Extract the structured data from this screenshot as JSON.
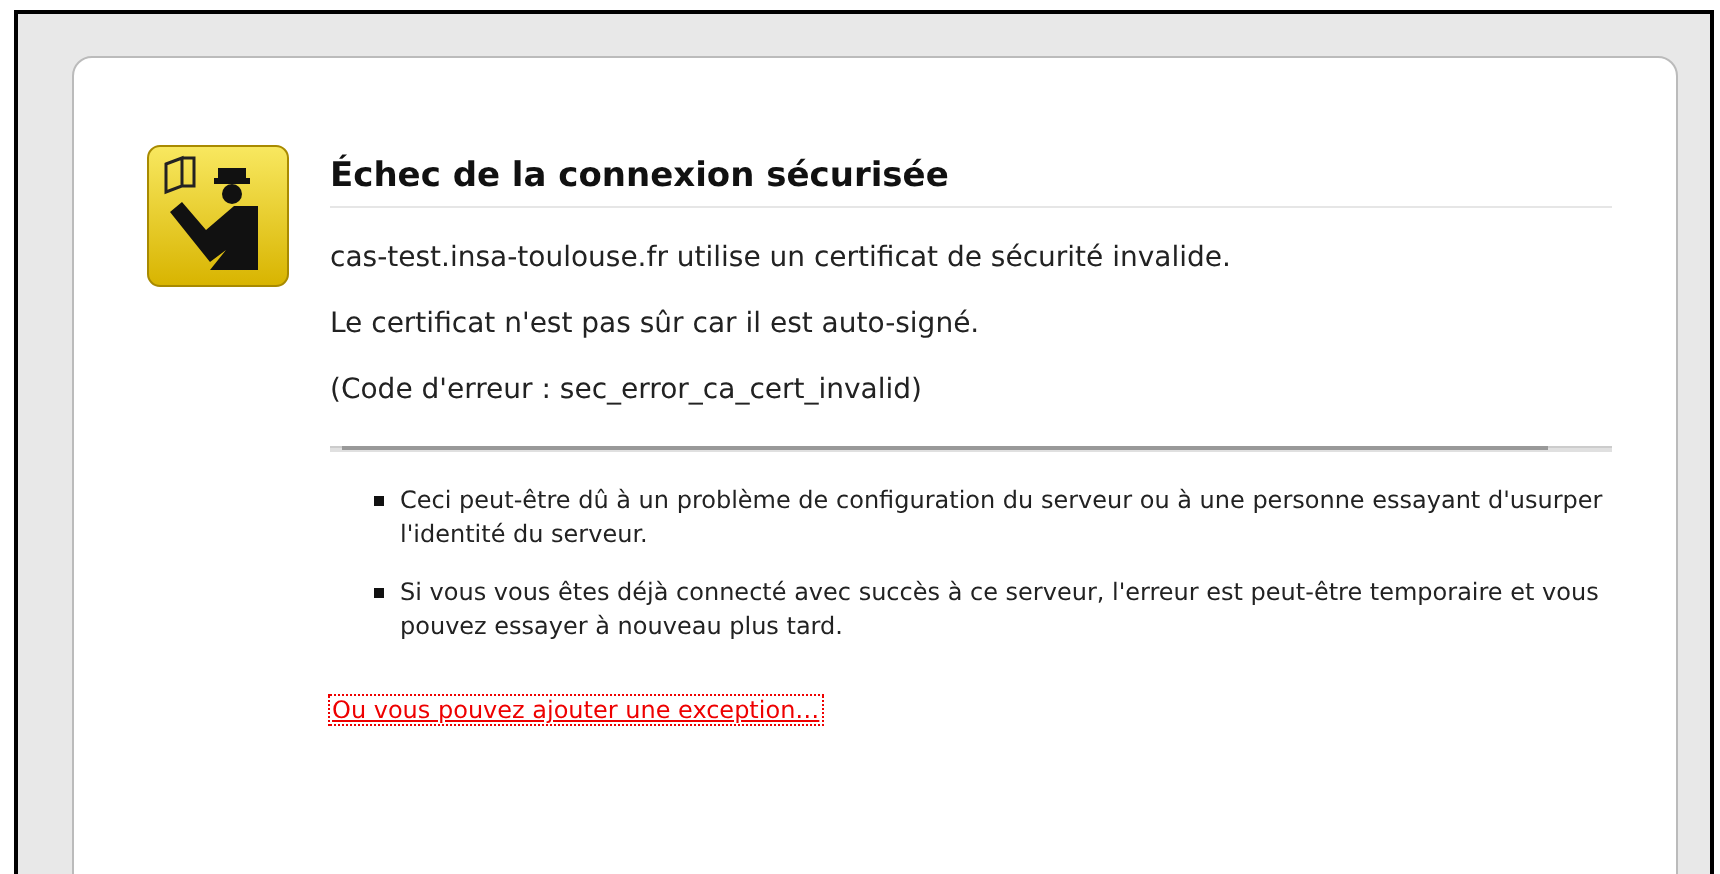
{
  "title": "Échec de la connexion sécurisée",
  "paragraphs": [
    "cas-test.insa-toulouse.fr utilise un certificat de sécurité invalide.",
    "Le certificat n'est pas sûr car il est auto-signé.",
    "(Code d'erreur : sec_error_ca_cert_invalid)"
  ],
  "bullets": [
    "Ceci peut-être dû à un problème de configuration du serveur ou à une personne essayant d'usurper l'identité du serveur.",
    "Si vous vous êtes déjà connecté avec succès à ce serveur, l'erreur est peut-être temporaire et vous pouvez essayer à nouveau plus tard."
  ],
  "exception_link": {
    "label": "Ou vous pouvez ajouter une exception…",
    "focused": true
  }
}
